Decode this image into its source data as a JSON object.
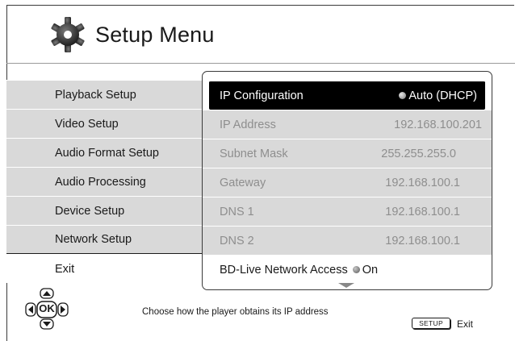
{
  "header": {
    "title": "Setup Menu",
    "icon": "gear-icon"
  },
  "menu": {
    "items": [
      {
        "label": "Playback Setup",
        "state": "shaded"
      },
      {
        "label": "Video Setup",
        "state": "shaded"
      },
      {
        "label": "Audio Format Setup",
        "state": "shaded"
      },
      {
        "label": "Audio Processing",
        "state": "shaded"
      },
      {
        "label": "Device Setup",
        "state": "shaded"
      },
      {
        "label": "Network Setup",
        "state": "active"
      },
      {
        "label": "Exit",
        "state": "plain"
      }
    ]
  },
  "network": {
    "rows": [
      {
        "label": "IP Configuration",
        "value": "Auto (DHCP)",
        "state": "selected",
        "radio": true
      },
      {
        "label": "IP Address",
        "value": "192.168.100.201",
        "state": "disabled",
        "radio": false
      },
      {
        "label": "Subnet Mask",
        "value": "255.255.255.0",
        "state": "disabled",
        "radio": false
      },
      {
        "label": "Gateway",
        "value": "192.168.100.1",
        "state": "disabled",
        "radio": false
      },
      {
        "label": "DNS 1",
        "value": "192.168.100.1",
        "state": "disabled",
        "radio": false
      },
      {
        "label": "DNS 2",
        "value": "192.168.100.1",
        "state": "disabled",
        "radio": false
      },
      {
        "label": "BD-Live Network Access",
        "value": "On",
        "state": "enabled",
        "radio": true
      }
    ]
  },
  "footer": {
    "ok_label": "OK",
    "help_text": "Choose how the player obtains its IP address",
    "setup_key": "SETUP",
    "exit_label": "Exit"
  },
  "colors": {
    "shaded_row": "#d9d9d9",
    "selected_row": "#000000",
    "disabled_text": "#8e8e8e"
  }
}
